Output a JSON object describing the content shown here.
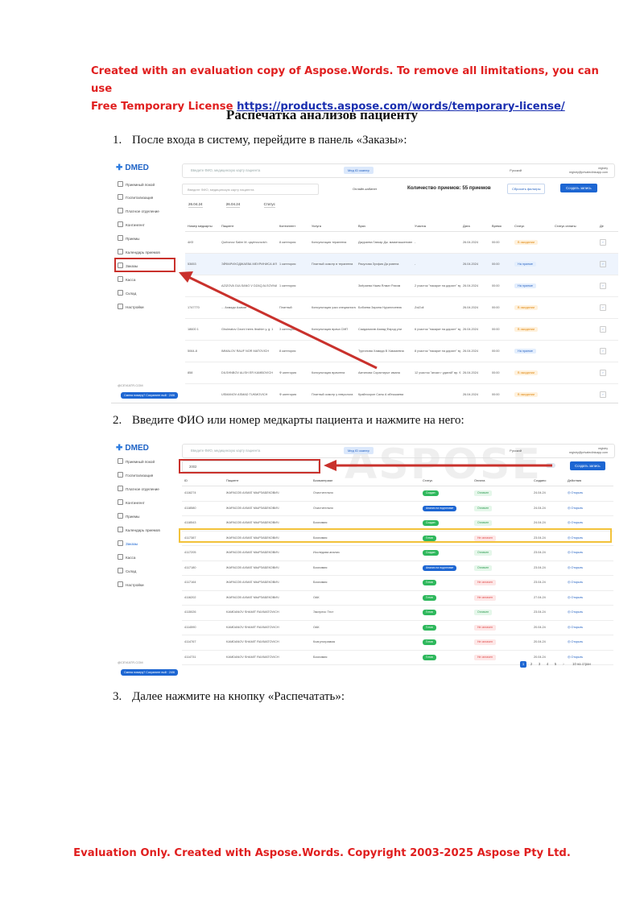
{
  "banner": {
    "line1": "Created with an evaluation copy of Aspose.Words. To remove all limitations, you can use",
    "line2_prefix": "Free Temporary License ",
    "link": "https://products.aspose.com/words/temporary-license/"
  },
  "doc_title": "Распечатка анализов пациенту",
  "steps": [
    {
      "num": "1.",
      "text": "После входа в систему, перейдите в панель «Заказы»:"
    },
    {
      "num": "2.",
      "text": "Введите ФИО или номер медкарты пациента и нажмите на него:"
    },
    {
      "num": "3.",
      "text": "Далее нажмите на кнопку «Распечатать»:"
    }
  ],
  "footer": "Evaluation Only. Created with Aspose.Words. Copyright 2003-2025 Aspose Pty Ltd.",
  "watermark": "ASPOSE",
  "app": {
    "logo": "DMED",
    "sidebar": [
      "Приемный покой",
      "Госпитализация",
      "Платное отделение",
      "Контингент",
      "Приемы",
      "Календарь приемов",
      "Заказы",
      "Касса",
      "Склад",
      "Настройки"
    ],
    "sidebar_footer": "@CEVIATR.COM",
    "sidebar_pill": "Смена номеру? Сохраните ный · 24/6",
    "search_placeholder": "Введите ФИО, медицинскую карту пациента",
    "qr_button": "Мед ID сканер",
    "language": "Русский",
    "user_name": "registry",
    "user_email": "registry@privateclinicapp.com"
  },
  "screen1": {
    "filter_placeholder": "Введите ФИО, медицинскую карту пациента",
    "online_label": "Онлайн-кабинет",
    "count_label": "Количество приемов: 55 приемов",
    "reset_button": "Сбросить фильтры",
    "create_button": "Создать запись",
    "date_from": "26.04.24",
    "date_to": "26.04.24",
    "status_filter": "Статус",
    "headers": [
      "Номер медкарты",
      "Пациент",
      "Контингент",
      "Услуга",
      "Врач",
      "Участок",
      "Дата",
      "Время",
      "Статус",
      "Статус оплаты",
      "Де"
    ],
    "rows": [
      {
        "card": "4ИЗ",
        "patient": "Qurbonov Salim M. qayimovovich",
        "cont": "8 категория",
        "service": "Консультация терапевта",
        "doctor": "Джураева Гавхар Дж. маматашкеновна",
        "plot": "-",
        "date": "26.04.2024",
        "time": "00:00",
        "status": "В ожидании",
        "done": false
      },
      {
        "card": "53653",
        "patient": "ЭЙФАРИХОДЖАЕВА МЕХРИНИСА ИЛХОМ БАЕВНА",
        "cont": "1 категория",
        "service": "Платный осмотр в терапевта",
        "doctor": "Расулова Зухфия Да ровена",
        "plot": "-",
        "date": "26.04.2024",
        "time": "00:00",
        "status": "На приеме",
        "done": true
      },
      {
        "card": "",
        "patient": "AZIZOVA GULSANO V DZAQ ALSOVNA",
        "cont": "1 категория",
        "service": "",
        "doctor": "Зиёраева Наим Ялмат Рахим",
        "plot": "2 участок \"пакарат на дарахт\" вр. Зиёхова Н. 3",
        "date": "26.04.2024",
        "time": "00:00",
        "status": "На приеме",
        "done": true
      },
      {
        "card": "1747770",
        "patient": "... Ахмади Азамат",
        "cont": "Платный",
        "service": "Консультация узко специалиста СМП",
        "doctor": "Бобоева Зарина Нуриллоевна",
        "plot": "ZoiZoli",
        "date": "26.04.2024",
        "time": "00:00",
        "status": "В ожидании",
        "done": false
      },
      {
        "card": "18600 1",
        "patient": "Ghulmatov Ozoni Inees Ibrahim у. g. 1",
        "cont": "3 категория",
        "service": "Консультация врача СМП",
        "doctor": "Саидахмоэв Ахмад Фарод ули",
        "plot": "6 участок \"пакарат на дарахт\" вр. Мадумова заа Т. К",
        "date": "26.04.2024",
        "time": "00:00",
        "status": "В ожидании",
        "done": false
      },
      {
        "card": "5064-8",
        "patient": "IMMALOV RAUF NOR MATOVICH",
        "cont": "8 категория",
        "service": "",
        "doctor": "Тургинова Хамида В Хамзаевна",
        "plot": "8 участок \"пакарат на дарахт\" вр. Тургинова Х.В",
        "date": "26.04.2024",
        "time": "00:00",
        "status": "На приеме",
        "done": true
      },
      {
        "card": "858",
        "patient": "DILSHNBOV ALISH ER KAMBOVICH",
        "cont": "Ф категория",
        "service": "Консультация врачевта",
        "doctor": "Амтинова Сорахтирыт имана",
        "plot": "12 участок \"анзал г удатай\" вр. Фазилов наек Б.О",
        "date": "26.04.2024",
        "time": "00:00",
        "status": "В ожидании",
        "done": false
      },
      {
        "card": "",
        "patient": "USMANOV ASMAD TUKMOVICH",
        "cont": "Ф категория",
        "service": "Платный осмотр у невролога",
        "doctor": "Крайпоорон Салж А ябтыжаева",
        "plot": "",
        "date": "26.04.2024",
        "time": "00:00",
        "status": "В ожидании",
        "done": false
      }
    ]
  },
  "screen2": {
    "search_value": "2002",
    "create_button": "Создать запись",
    "headers": [
      "ID",
      "Пациент",
      "Биоматериал",
      "Статус",
      "Оплата",
      "Создано",
      "Действия"
    ],
    "rows": [
      {
        "id": "4116274",
        "patient": "ЖАРАСОВ АХМАТ МЫРЗАБЕКОВИЧ",
        "bio": "Очистительно",
        "status": "Создан",
        "status_blue": false,
        "pay": "Оплачен",
        "paid": true,
        "date": "24.04.24",
        "action": "Открыть"
      },
      {
        "id": "4118580",
        "patient": "ЖАРАСОВ АХМАТ МЫРЗАБЕКОВИЧ",
        "bio": "Очистительно",
        "status": "Анализ на подготовке",
        "status_blue": true,
        "pay": "Оплачен",
        "paid": true,
        "date": "24.04.24",
        "action": "Открыть"
      },
      {
        "id": "4118543",
        "patient": "ЖАРАСОВ АХМАТ МЫРЗАБЕКОВИЧ",
        "bio": "Биохимия",
        "status": "Создан",
        "status_blue": false,
        "pay": "Оплачен",
        "paid": true,
        "date": "24.04.24",
        "action": "Открыть"
      },
      {
        "id": "4117387",
        "patient": "ЖАРАСОВ АХМАТ МЫРЗАБЕКОВИЧ",
        "bio": "Биохимия",
        "status": "Готов",
        "status_blue": false,
        "pay": "Не оплачен",
        "paid": false,
        "date": "23.04.24",
        "action": "Открыть"
      },
      {
        "id": "4117205",
        "patient": "ЖАРАСОВ АХМАТ МЫРЗАБЕКОВИЧ",
        "bio": "Исследова анализ",
        "status": "Создан",
        "status_blue": false,
        "pay": "Оплачен",
        "paid": true,
        "date": "23.04.24",
        "action": "Открыть"
      },
      {
        "id": "4117180",
        "patient": "ЖАРАСОВ АХМАТ МЫРЗАБЕКОВИЧ",
        "bio": "Биохимия",
        "status": "Анализ на подготовке",
        "status_blue": true,
        "pay": "Оплачен",
        "paid": true,
        "date": "23.04.24",
        "action": "Открыть"
      },
      {
        "id": "4117164",
        "patient": "ЖАРАСОВ АХМАТ МЫРЗАБЕКОВИЧ",
        "bio": "Биохимия",
        "status": "Готов",
        "status_blue": false,
        "pay": "Не оплачен",
        "paid": false,
        "date": "23.04.24",
        "action": "Открыть"
      },
      {
        "id": "4116202",
        "patient": "ЖАРАСОВ АХМАТ МЫРЗАБЕКОВИЧ",
        "bio": "ОАК",
        "status": "Готов",
        "status_blue": false,
        "pay": "Не оплачен",
        "paid": false,
        "date": "27.04.24",
        "action": "Открыть"
      },
      {
        "id": "4115026",
        "patient": "KAMDANOV SHAMIT RAXMATOVICH",
        "bio": "Экспресс Тест",
        "status": "Готов",
        "status_blue": false,
        "pay": "Оплачен",
        "paid": true,
        "date": "23.04.24",
        "action": "Открыть"
      },
      {
        "id": "4114590",
        "patient": "KAMDANOV SHAMIT RAXMATOVICH",
        "bio": "ОАК",
        "status": "Готов",
        "status_blue": false,
        "pay": "Не оплачен",
        "paid": false,
        "date": "20.04.24",
        "action": "Открыть"
      },
      {
        "id": "4114767",
        "patient": "KAMDANOV SHAMIT RAXMATOVICH",
        "bio": "Коагулограмма",
        "status": "Готов",
        "status_blue": false,
        "pay": "Не оплачен",
        "paid": false,
        "date": "20.04.24",
        "action": "Открыть"
      },
      {
        "id": "4114731",
        "patient": "KAMDANOV SHAMIT RAXMATOVICH",
        "bio": "Биохимия",
        "status": "Готов",
        "status_blue": false,
        "pay": "Не оплачен",
        "paid": false,
        "date": "20.04.24",
        "action": "Открыть"
      }
    ],
    "pages": [
      "1",
      "2",
      "3",
      "4",
      "5",
      "›"
    ],
    "per_page": "10 на стран"
  },
  "colors": {
    "accent": "#1d66d2",
    "highlight_red": "#c9312c",
    "highlight_yellow": "#f2c23a",
    "evaluation_text": "#e01f1f"
  }
}
